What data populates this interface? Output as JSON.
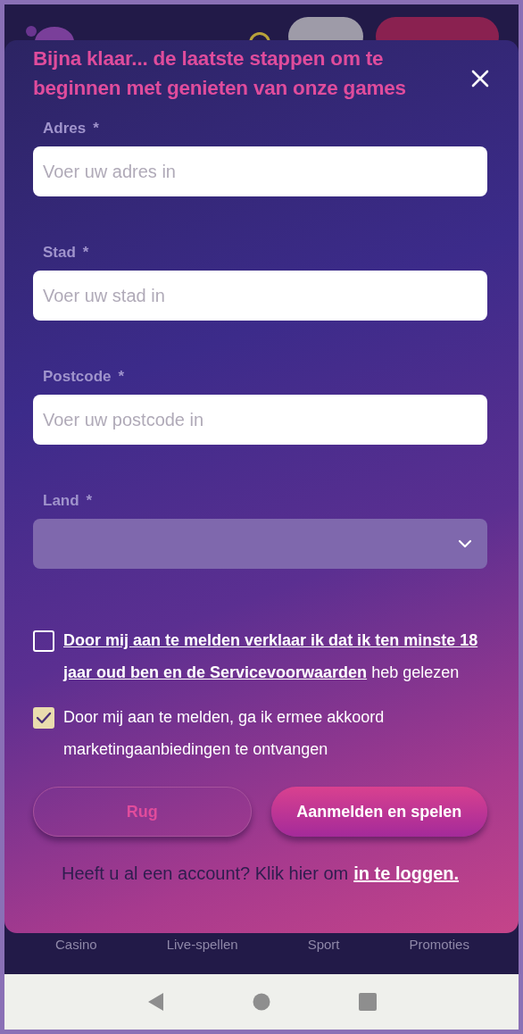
{
  "header": {
    "buttons": [
      {
        "kind": "secondary"
      },
      {
        "kind": "primary"
      }
    ]
  },
  "modal": {
    "title": "Bijna klaar... de laatste stappen om te beginnen met genieten van onze games",
    "fields": [
      {
        "kind": "text",
        "label": "Adres",
        "mark": "*",
        "placeholder": "Voer uw adres in"
      },
      {
        "kind": "text",
        "label": "Stad",
        "mark": "*",
        "placeholder": "Voer uw stad in"
      },
      {
        "kind": "text",
        "label": "Postcode",
        "mark": "*",
        "placeholder": "Voer uw postcode in"
      },
      {
        "kind": "select",
        "label": "Land",
        "mark": "*"
      }
    ],
    "checkboxes": [
      {
        "text": "**Door mij aan te melden verklaar ik dat ik ten minste 18 jaar oud ben en de Servicevoorwaarden** heb gelezen",
        "checked": false
      },
      {
        "text": "Door mij aan te melden, ga ik ermee akkoord marketingaanbiedingen te ontvangen",
        "checked": true
      }
    ],
    "buttons": [
      {
        "label": "Rug",
        "kind": "secondary"
      },
      {
        "label": "Aanmelden en spelen",
        "kind": "primary"
      }
    ],
    "login_prompt": {
      "text": "Heeft u al een account? Klik hier om",
      "link": "in te loggen."
    }
  },
  "bottom_nav": [
    "Casino",
    "Live-spellen",
    "Sport",
    "Promoties"
  ]
}
